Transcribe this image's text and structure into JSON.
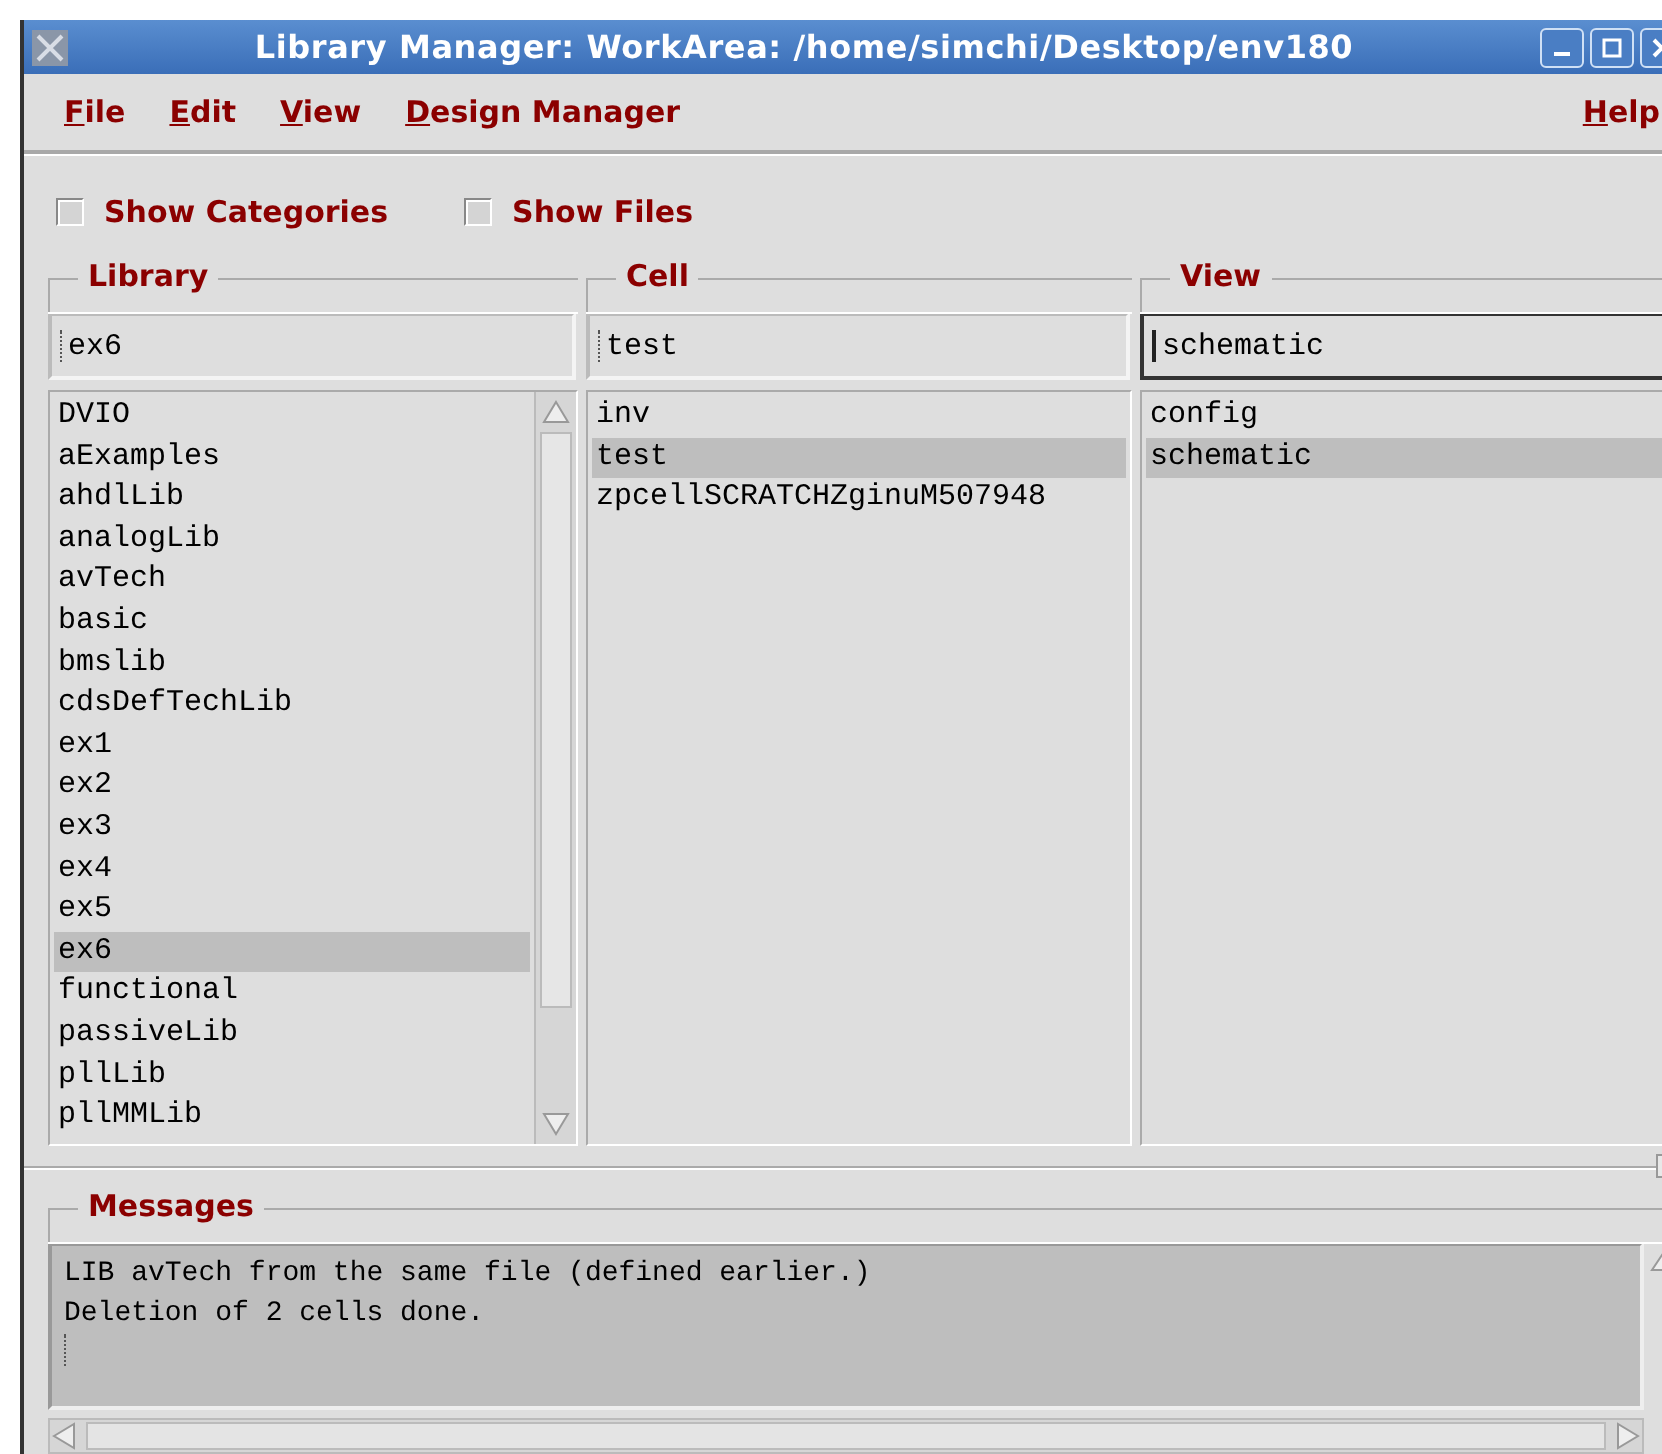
{
  "window": {
    "title": "Library Manager: WorkArea: /home/simchi/Desktop/env180"
  },
  "menu": [
    {
      "label": "File"
    },
    {
      "label": "Edit"
    },
    {
      "label": "View"
    },
    {
      "label": "Design Manager"
    }
  ],
  "help_menu": {
    "label": "Help"
  },
  "options": [
    {
      "label": "Show Categories",
      "checked": false
    },
    {
      "label": "Show Files",
      "checked": false
    }
  ],
  "columns": [
    {
      "title": "Library",
      "value": "ex6",
      "focused": false,
      "scrollbar": true,
      "items": [
        {
          "label": "DVIO",
          "selected": false
        },
        {
          "label": "aExamples",
          "selected": false
        },
        {
          "label": "ahdlLib",
          "selected": false
        },
        {
          "label": "analogLib",
          "selected": false
        },
        {
          "label": "avTech",
          "selected": false
        },
        {
          "label": "basic",
          "selected": false
        },
        {
          "label": "bmslib",
          "selected": false
        },
        {
          "label": "cdsDefTechLib",
          "selected": false
        },
        {
          "label": "ex1",
          "selected": false
        },
        {
          "label": "ex2",
          "selected": false
        },
        {
          "label": "ex3",
          "selected": false
        },
        {
          "label": "ex4",
          "selected": false
        },
        {
          "label": "ex5",
          "selected": false
        },
        {
          "label": "ex6",
          "selected": true
        },
        {
          "label": "functional",
          "selected": false
        },
        {
          "label": "passiveLib",
          "selected": false
        },
        {
          "label": "pllLib",
          "selected": false
        },
        {
          "label": "pllMMLib",
          "selected": false
        }
      ]
    },
    {
      "title": "Cell",
      "value": "test",
      "focused": false,
      "scrollbar": false,
      "items": [
        {
          "label": "inv",
          "selected": false
        },
        {
          "label": "test",
          "selected": true
        },
        {
          "label": "zpcellSCRATCHZginuM507948",
          "selected": false
        }
      ]
    },
    {
      "title": "View",
      "value": "schematic",
      "focused": true,
      "scrollbar": false,
      "items": [
        {
          "label": "config",
          "selected": false
        },
        {
          "label": "schematic",
          "selected": true
        }
      ]
    }
  ],
  "messages": {
    "title": "Messages",
    "lines": [
      "LIB avTech from the same file (defined earlier.)",
      "Deletion of 2 cells done."
    ]
  }
}
